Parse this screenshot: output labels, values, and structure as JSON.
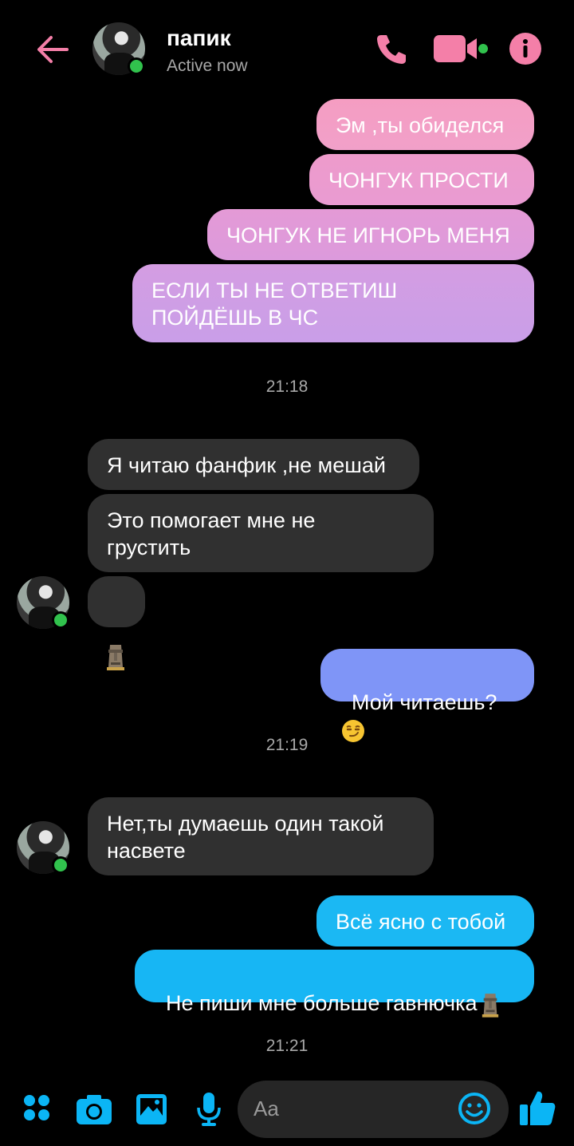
{
  "header": {
    "name": "папик",
    "status": "Active now"
  },
  "messages": {
    "m1": "Эм ,ты обиделся",
    "m2": "ЧОНГУК ПРОСТИ",
    "m3": "ЧОНГУК НЕ ИГНОРЬ МЕНЯ",
    "m4": "ЕСЛИ ТЫ НЕ ОТВЕТИШ\nПОЙДЁШЬ В ЧС",
    "t1": "21:18",
    "m5": "Я читаю фанфик ,не мешай",
    "m6": "Это помогает мне не\nгрустить",
    "m7_emoji": "moai",
    "m8": "Мой читаешь?",
    "m8_emoji": "smirking-face",
    "t2": "21:19",
    "m9": "Нет,ты думаешь один такой\nнасвете",
    "m10": "Всё ясно с тобой",
    "m11": "Не пиши мне больше гавнючка",
    "m11_emoji": "moai",
    "t3": "21:21"
  },
  "composer": {
    "placeholder": "Aa"
  },
  "colors": {
    "accent_pink": "#f47fa8",
    "accent_blue": "#0bb5f5",
    "incoming_bg": "#303030",
    "online": "#31c24d"
  }
}
